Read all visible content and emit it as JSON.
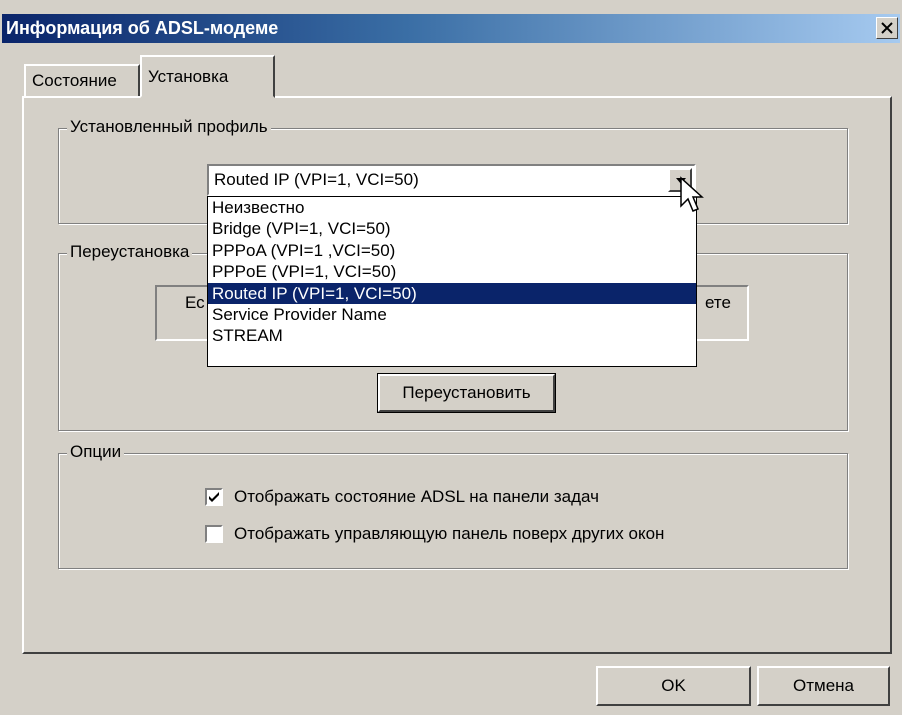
{
  "window": {
    "title": "Информация об ADSL-модеме"
  },
  "tabs": [
    {
      "label": "Состояние"
    },
    {
      "label": "Установка"
    }
  ],
  "profile_group": {
    "title": "Установленный профиль",
    "combo_value": "Routed IP (VPI=1, VCI=50)",
    "options": [
      {
        "label": "Неизвестно"
      },
      {
        "label": "Bridge (VPI=1, VCI=50)"
      },
      {
        "label": "PPPoA (VPI=1 ,VCI=50)"
      },
      {
        "label": "PPPoE (VPI=1, VCI=50)"
      },
      {
        "label": "Routed IP (VPI=1, VCI=50)"
      },
      {
        "label": "Service Provider Name"
      },
      {
        "label": "STREAM"
      }
    ],
    "selected_index": 4
  },
  "reinstall_group": {
    "title": "Переустановка",
    "info_left": "Ес",
    "info_right": "ете",
    "button_label": "Переустановить"
  },
  "options_group": {
    "title": "Опции",
    "checkboxes": [
      {
        "label": "Отображать состояние ADSL на панели задач",
        "checked": true
      },
      {
        "label": "Отображать управляющую панель поверх других окон",
        "checked": false
      }
    ]
  },
  "footer": {
    "ok_label": "OK",
    "cancel_label": "Отмена"
  },
  "colors": {
    "face": "#d4d0c8",
    "title_start": "#0a246a",
    "title_end": "#a6caf0",
    "selection": "#0a246a"
  }
}
